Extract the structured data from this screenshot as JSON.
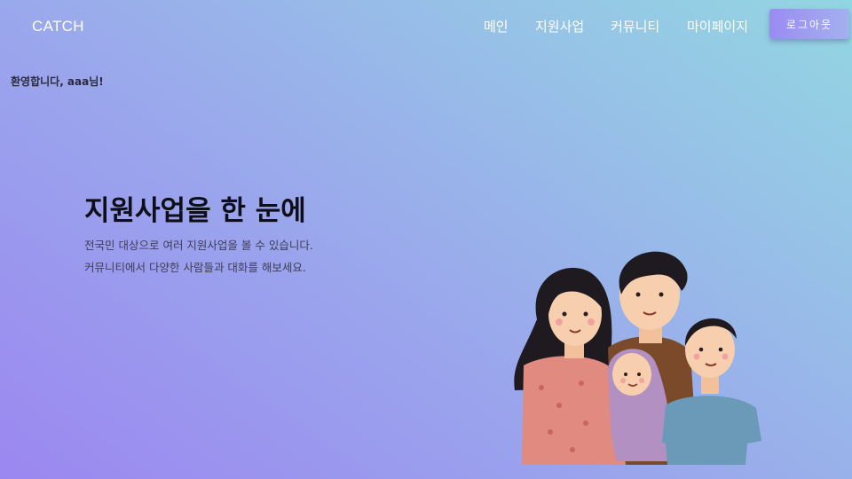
{
  "header": {
    "logo": "CATCH",
    "nav": [
      {
        "label": "메인"
      },
      {
        "label": "지원사업"
      },
      {
        "label": "커뮤니티"
      },
      {
        "label": "마이페이지"
      }
    ],
    "logout_label": "로그아웃"
  },
  "welcome": "환영합니다, aaa님!",
  "hero": {
    "title": "지원사업을 한 눈에",
    "desc_line1": "전국민 대상으로 여러 지원사업을 볼 수 있습니다.",
    "desc_line2": "커뮤니티에서 다양한 사람들과 대화를 해보세요."
  },
  "colors": {
    "gradient_start": "#9b87f0",
    "gradient_end": "#92d6e2",
    "title_text": "#0f0f1a",
    "nav_text": "#ffffff"
  }
}
